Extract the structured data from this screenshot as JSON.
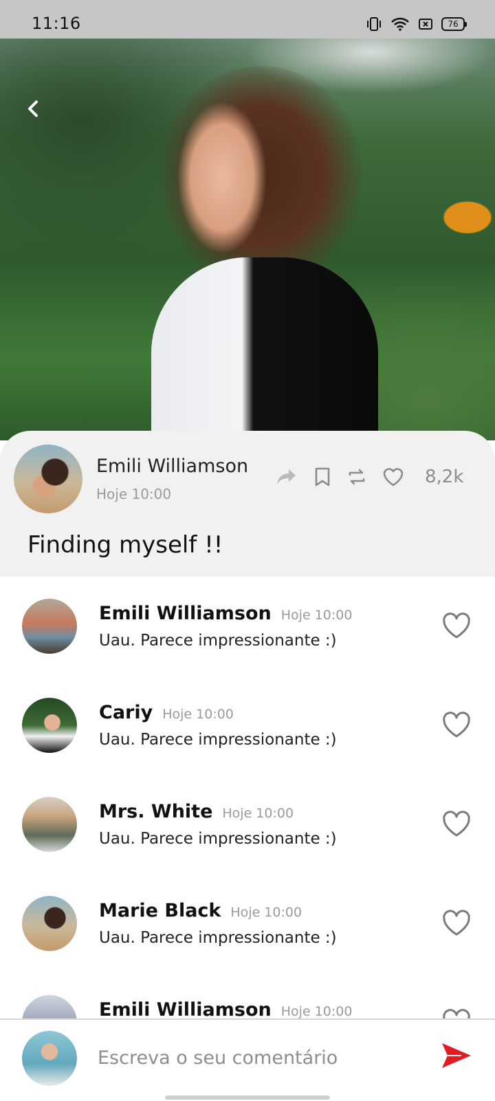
{
  "status_bar": {
    "time": "11:16",
    "battery": "76"
  },
  "post": {
    "author": "Emili Williamson",
    "time": "Hoje 10:00",
    "title": "Finding myself !!",
    "likes": "8,2k"
  },
  "comments": [
    {
      "name": "Emili Williamson",
      "time": "Hoje 10:00",
      "text": "Uau. Parece impressionante :)"
    },
    {
      "name": "Cariy",
      "time": "Hoje 10:00",
      "text": "Uau. Parece impressionante :)"
    },
    {
      "name": "Mrs. White",
      "time": "Hoje 10:00",
      "text": "Uau. Parece impressionante :)"
    },
    {
      "name": "Marie Black",
      "time": "Hoje 10:00",
      "text": "Uau. Parece impressionante :)"
    },
    {
      "name": "Emili Williamson",
      "time": "Hoje 10:00",
      "text": ""
    }
  ],
  "composer": {
    "placeholder": "Escreva o seu comentário"
  },
  "icons": {
    "back": "chevron-left-icon",
    "share": "share-arrow-icon",
    "bookmark": "bookmark-icon",
    "repost": "repeat-icon",
    "like": "heart-icon",
    "send": "send-icon"
  },
  "colors": {
    "accent_send": "#e11b22",
    "card_bg": "#f1f1f1",
    "muted": "#9a9a9a"
  }
}
